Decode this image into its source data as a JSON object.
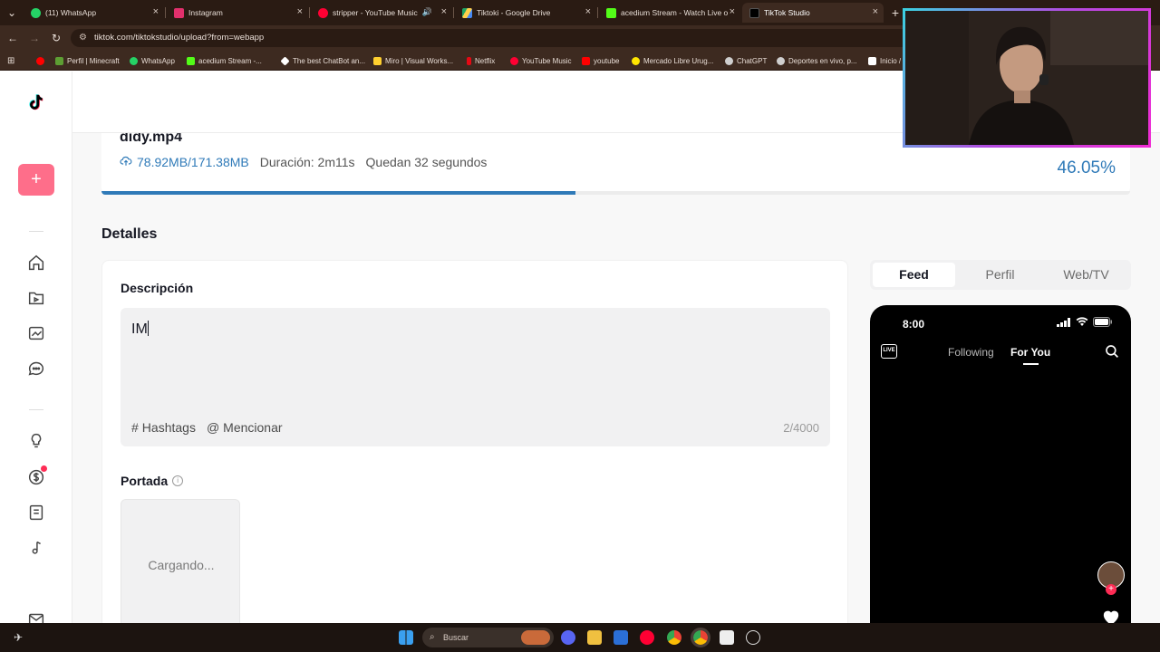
{
  "browser": {
    "tabs": [
      {
        "label": "(11) WhatsApp",
        "icon": "whatsapp-icon",
        "color": "#25d366"
      },
      {
        "label": "Instagram",
        "icon": "instagram-icon",
        "color": "#e1306c"
      },
      {
        "label": "stripper - YouTube Music",
        "icon": "youtube-music-icon",
        "color": "#ff0033"
      },
      {
        "label": "Tiktoki - Google Drive",
        "icon": "google-drive-icon",
        "color": "#1fa463"
      },
      {
        "label": "acedium Stream - Watch Live o",
        "icon": "kick-icon",
        "color": "#53fc18"
      },
      {
        "label": "TikTok Studio",
        "icon": "tiktok-icon",
        "color": "#000000"
      }
    ],
    "url": "tiktok.com/tiktokstudio/upload?from=webapp",
    "bookmarks": [
      {
        "label": "",
        "icon": "youtube-icon",
        "color": "#ff0000"
      },
      {
        "label": "Perfil | Minecraft",
        "icon": "minecraft-icon",
        "color": "#5d9e33"
      },
      {
        "label": "WhatsApp",
        "icon": "whatsapp-icon",
        "color": "#25d366"
      },
      {
        "label": "acedium Stream -...",
        "icon": "kick-icon",
        "color": "#53fc18"
      },
      {
        "label": "The best ChatBot an...",
        "icon": "chatbot-icon",
        "color": "#ffffff"
      },
      {
        "label": "Miro | Visual Works...",
        "icon": "miro-icon",
        "color": "#ffd02f"
      },
      {
        "label": "Netflix",
        "icon": "netflix-icon",
        "color": "#e50914"
      },
      {
        "label": "YouTube Music",
        "icon": "youtube-music-icon",
        "color": "#ff0033"
      },
      {
        "label": "youtube",
        "icon": "youtube-icon",
        "color": "#ff0000"
      },
      {
        "label": "Mercado Libre Urug...",
        "icon": "mercadolibre-icon",
        "color": "#ffe600"
      },
      {
        "label": "ChatGPT",
        "icon": "chatgpt-icon",
        "color": "#cfcfcf"
      },
      {
        "label": "Deportes en vivo, p...",
        "icon": "sports-icon",
        "color": "#cfcfcf"
      },
      {
        "label": "Inicio /",
        "icon": "x-icon",
        "color": "#ffffff"
      }
    ]
  },
  "upload": {
    "filename": "didy.mp4",
    "size": "78.92MB/171.38MB",
    "duration": "Duración: 2m11s",
    "remaining": "Quedan 32 segundos",
    "percent_text": "46.05%",
    "progress": 0.4605
  },
  "details": {
    "heading": "Detalles",
    "description_label": "Descripción",
    "description_value": "IM",
    "hashtags_label": "Hashtags",
    "mention_label": "Mencionar",
    "char_count": "2/4000",
    "cover_label": "Portada",
    "cover_loading": "Cargando..."
  },
  "preview": {
    "tabs": [
      "Feed",
      "Perfil",
      "Web/TV"
    ],
    "active_tab": "Feed",
    "phone_time": "8:00",
    "live_label": "LIVE",
    "following": "Following",
    "for_you": "For You"
  },
  "taskbar": {
    "search_placeholder": "Buscar"
  },
  "colors": {
    "accent_blue": "#2f7ab8",
    "tiktok_pink": "#fe2c55",
    "browser_frame": "#3d2a20"
  }
}
